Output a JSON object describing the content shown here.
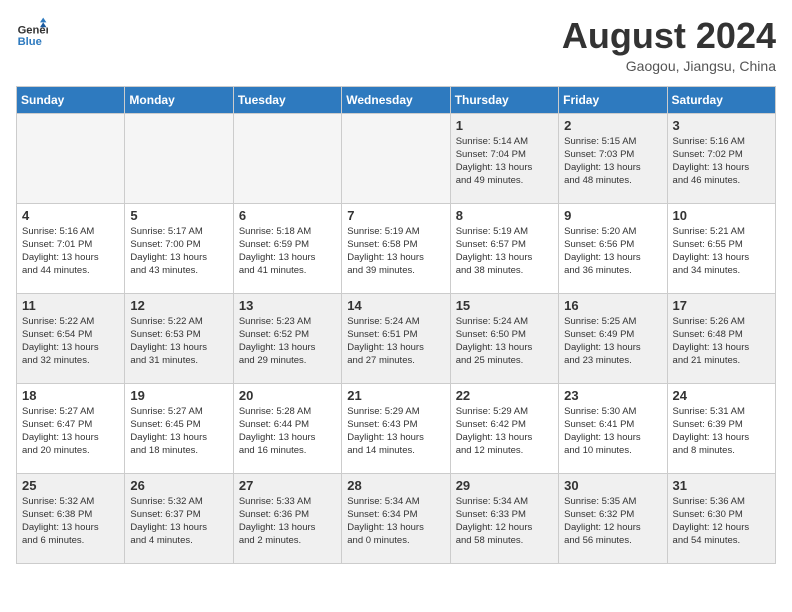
{
  "header": {
    "logo_line1": "General",
    "logo_line2": "Blue",
    "month_title": "August 2024",
    "location": "Gaogou, Jiangsu, China"
  },
  "weekdays": [
    "Sunday",
    "Monday",
    "Tuesday",
    "Wednesday",
    "Thursday",
    "Friday",
    "Saturday"
  ],
  "weeks": [
    [
      {
        "day": "",
        "info": "",
        "empty": true
      },
      {
        "day": "",
        "info": "",
        "empty": true
      },
      {
        "day": "",
        "info": "",
        "empty": true
      },
      {
        "day": "",
        "info": "",
        "empty": true
      },
      {
        "day": "1",
        "info": "Sunrise: 5:14 AM\nSunset: 7:04 PM\nDaylight: 13 hours\nand 49 minutes.",
        "empty": false
      },
      {
        "day": "2",
        "info": "Sunrise: 5:15 AM\nSunset: 7:03 PM\nDaylight: 13 hours\nand 48 minutes.",
        "empty": false
      },
      {
        "day": "3",
        "info": "Sunrise: 5:16 AM\nSunset: 7:02 PM\nDaylight: 13 hours\nand 46 minutes.",
        "empty": false
      }
    ],
    [
      {
        "day": "4",
        "info": "Sunrise: 5:16 AM\nSunset: 7:01 PM\nDaylight: 13 hours\nand 44 minutes.",
        "empty": false
      },
      {
        "day": "5",
        "info": "Sunrise: 5:17 AM\nSunset: 7:00 PM\nDaylight: 13 hours\nand 43 minutes.",
        "empty": false
      },
      {
        "day": "6",
        "info": "Sunrise: 5:18 AM\nSunset: 6:59 PM\nDaylight: 13 hours\nand 41 minutes.",
        "empty": false
      },
      {
        "day": "7",
        "info": "Sunrise: 5:19 AM\nSunset: 6:58 PM\nDaylight: 13 hours\nand 39 minutes.",
        "empty": false
      },
      {
        "day": "8",
        "info": "Sunrise: 5:19 AM\nSunset: 6:57 PM\nDaylight: 13 hours\nand 38 minutes.",
        "empty": false
      },
      {
        "day": "9",
        "info": "Sunrise: 5:20 AM\nSunset: 6:56 PM\nDaylight: 13 hours\nand 36 minutes.",
        "empty": false
      },
      {
        "day": "10",
        "info": "Sunrise: 5:21 AM\nSunset: 6:55 PM\nDaylight: 13 hours\nand 34 minutes.",
        "empty": false
      }
    ],
    [
      {
        "day": "11",
        "info": "Sunrise: 5:22 AM\nSunset: 6:54 PM\nDaylight: 13 hours\nand 32 minutes.",
        "empty": false
      },
      {
        "day": "12",
        "info": "Sunrise: 5:22 AM\nSunset: 6:53 PM\nDaylight: 13 hours\nand 31 minutes.",
        "empty": false
      },
      {
        "day": "13",
        "info": "Sunrise: 5:23 AM\nSunset: 6:52 PM\nDaylight: 13 hours\nand 29 minutes.",
        "empty": false
      },
      {
        "day": "14",
        "info": "Sunrise: 5:24 AM\nSunset: 6:51 PM\nDaylight: 13 hours\nand 27 minutes.",
        "empty": false
      },
      {
        "day": "15",
        "info": "Sunrise: 5:24 AM\nSunset: 6:50 PM\nDaylight: 13 hours\nand 25 minutes.",
        "empty": false
      },
      {
        "day": "16",
        "info": "Sunrise: 5:25 AM\nSunset: 6:49 PM\nDaylight: 13 hours\nand 23 minutes.",
        "empty": false
      },
      {
        "day": "17",
        "info": "Sunrise: 5:26 AM\nSunset: 6:48 PM\nDaylight: 13 hours\nand 21 minutes.",
        "empty": false
      }
    ],
    [
      {
        "day": "18",
        "info": "Sunrise: 5:27 AM\nSunset: 6:47 PM\nDaylight: 13 hours\nand 20 minutes.",
        "empty": false
      },
      {
        "day": "19",
        "info": "Sunrise: 5:27 AM\nSunset: 6:45 PM\nDaylight: 13 hours\nand 18 minutes.",
        "empty": false
      },
      {
        "day": "20",
        "info": "Sunrise: 5:28 AM\nSunset: 6:44 PM\nDaylight: 13 hours\nand 16 minutes.",
        "empty": false
      },
      {
        "day": "21",
        "info": "Sunrise: 5:29 AM\nSunset: 6:43 PM\nDaylight: 13 hours\nand 14 minutes.",
        "empty": false
      },
      {
        "day": "22",
        "info": "Sunrise: 5:29 AM\nSunset: 6:42 PM\nDaylight: 13 hours\nand 12 minutes.",
        "empty": false
      },
      {
        "day": "23",
        "info": "Sunrise: 5:30 AM\nSunset: 6:41 PM\nDaylight: 13 hours\nand 10 minutes.",
        "empty": false
      },
      {
        "day": "24",
        "info": "Sunrise: 5:31 AM\nSunset: 6:39 PM\nDaylight: 13 hours\nand 8 minutes.",
        "empty": false
      }
    ],
    [
      {
        "day": "25",
        "info": "Sunrise: 5:32 AM\nSunset: 6:38 PM\nDaylight: 13 hours\nand 6 minutes.",
        "empty": false
      },
      {
        "day": "26",
        "info": "Sunrise: 5:32 AM\nSunset: 6:37 PM\nDaylight: 13 hours\nand 4 minutes.",
        "empty": false
      },
      {
        "day": "27",
        "info": "Sunrise: 5:33 AM\nSunset: 6:36 PM\nDaylight: 13 hours\nand 2 minutes.",
        "empty": false
      },
      {
        "day": "28",
        "info": "Sunrise: 5:34 AM\nSunset: 6:34 PM\nDaylight: 13 hours\nand 0 minutes.",
        "empty": false
      },
      {
        "day": "29",
        "info": "Sunrise: 5:34 AM\nSunset: 6:33 PM\nDaylight: 12 hours\nand 58 minutes.",
        "empty": false
      },
      {
        "day": "30",
        "info": "Sunrise: 5:35 AM\nSunset: 6:32 PM\nDaylight: 12 hours\nand 56 minutes.",
        "empty": false
      },
      {
        "day": "31",
        "info": "Sunrise: 5:36 AM\nSunset: 6:30 PM\nDaylight: 12 hours\nand 54 minutes.",
        "empty": false
      }
    ]
  ]
}
